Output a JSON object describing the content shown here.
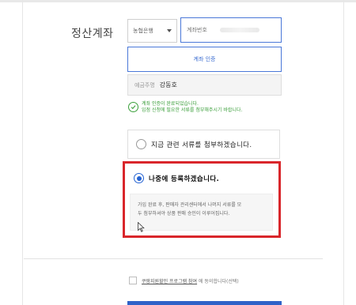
{
  "section": {
    "label": "정산계좌"
  },
  "bank_select": {
    "value": "농협은행"
  },
  "account_input": {
    "label": "계좌번호"
  },
  "verify_button": {
    "label": "계좌 인증"
  },
  "holder": {
    "label": "예금주명",
    "name": "강동호"
  },
  "success": {
    "line1": "계좌 인증이 완료되었습니다.",
    "line2": "입점 신청에 필요한 서류를 첨부해주시기 바랍니다."
  },
  "options": {
    "attach_now": {
      "label": "지금 관련 서류를 첨부하겠습니다.",
      "selected": false
    },
    "register_later": {
      "label": "나중에 등록하겠습니다.",
      "selected": true
    }
  },
  "info": {
    "line1": "가입 완료 후, 판매자 관리센터에서 나머지 서류를 모",
    "line2": "두 첨부하셔야 상품 판매 승인이 이루어집니다."
  },
  "agreement": {
    "link_text": "쿠팡지원할인 프로그램 참여",
    "suffix_text": "에 동의합니다(선택)",
    "checked": false
  },
  "colors": {
    "accent": "#4a78d8",
    "success": "#3a9e3a",
    "highlight_frame": "#d9262b",
    "radio_selected": "#2463d3"
  }
}
